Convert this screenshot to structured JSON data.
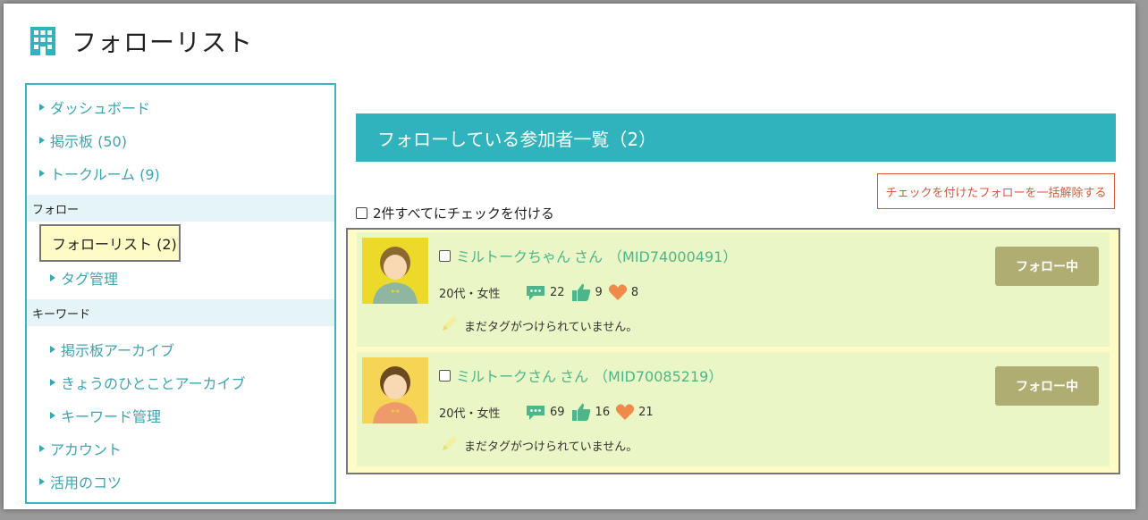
{
  "page": {
    "title": "フォローリスト",
    "icon": "building-icon"
  },
  "colors": {
    "accent": "#31b3bd",
    "follow_button": "#b0ad73",
    "card_bg": "#eaf6c5",
    "highlight": "#fffbc6",
    "warn": "#d65a3a",
    "name": "#4cb68a"
  },
  "sidebar": {
    "items_top": [
      {
        "label": "ダッシュボード"
      },
      {
        "label": "掲示板 (50)"
      },
      {
        "label": "トークルーム (9)"
      }
    ],
    "follow_section": {
      "heading": "フォロー",
      "active_item": "フォローリスト (2)",
      "items": [
        {
          "label": "タグ管理"
        }
      ]
    },
    "keyword_section": {
      "heading": "キーワード",
      "items": [
        {
          "label": "掲示板アーカイブ"
        },
        {
          "label": "きょうのひとことアーカイブ"
        },
        {
          "label": "キーワード管理"
        }
      ]
    },
    "items_bottom": [
      {
        "label": "アカウント"
      },
      {
        "label": "活用のコツ"
      }
    ]
  },
  "main": {
    "section_title": "フォローしている参加者一覧（2）",
    "bulk_unfollow_label": "チェックを付けたフォローを一括解除する",
    "check_all_label": "2件すべてにチェックを付ける",
    "members": [
      {
        "name": "ミルトークちゃん",
        "suffix": "さん",
        "mid": "（MID74000491）",
        "profile": "20代・女性",
        "comments": "22",
        "likes": "9",
        "hearts": "8",
        "tag_text": "まだタグがつけられていません。",
        "follow_label": "フォロー中",
        "avatar_bg": "#ecd92a"
      },
      {
        "name": "ミルトークさん",
        "suffix": "さん",
        "mid": "（MID70085219）",
        "profile": "20代・女性",
        "comments": "69",
        "likes": "16",
        "hearts": "21",
        "tag_text": "まだタグがつけられていません。",
        "follow_label": "フォロー中",
        "avatar_bg": "#f6d456"
      }
    ]
  }
}
